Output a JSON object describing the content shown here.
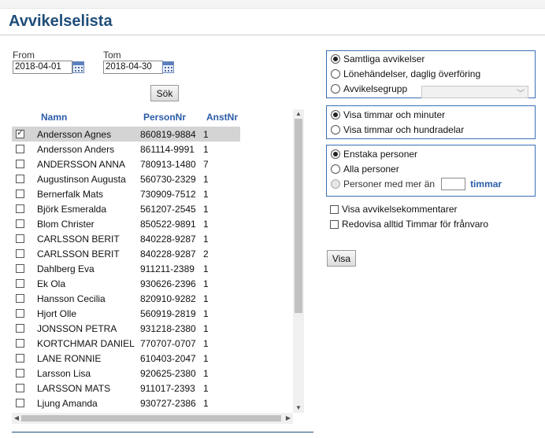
{
  "page": {
    "title": "Avvikelselista"
  },
  "filters": {
    "from_label": "From",
    "from_value": "2018-04-01",
    "tom_label": "Tom",
    "tom_value": "2018-04-30",
    "search_button": "Sök"
  },
  "list": {
    "columns": {
      "name": "Namn",
      "pnr": "PersonNr",
      "anst": "AnstNr"
    },
    "rows": [
      {
        "name": "Andersson Agnes",
        "pnr": "860819-9884",
        "anst": "1",
        "checked": true,
        "selected": true
      },
      {
        "name": "Andersson Anders",
        "pnr": "861114-9991",
        "anst": "1"
      },
      {
        "name": "ANDERSSON ANNA",
        "pnr": "780913-1480",
        "anst": "7"
      },
      {
        "name": "Augustinson Augusta",
        "pnr": "560730-2329",
        "anst": "1"
      },
      {
        "name": "Bernerfalk Mats",
        "pnr": "730909-7512",
        "anst": "1"
      },
      {
        "name": "Björk Esmeralda",
        "pnr": "561207-2545",
        "anst": "1"
      },
      {
        "name": "Blom Christer",
        "pnr": "850522-9891",
        "anst": "1"
      },
      {
        "name": "CARLSSON BERIT",
        "pnr": "840228-9287",
        "anst": "1"
      },
      {
        "name": "CARLSSON BERIT",
        "pnr": "840228-9287",
        "anst": "2"
      },
      {
        "name": "Dahlberg Eva",
        "pnr": "911211-2389",
        "anst": "1"
      },
      {
        "name": "Ek Ola",
        "pnr": "930626-2396",
        "anst": "1"
      },
      {
        "name": "Hansson Cecilia",
        "pnr": "820910-9282",
        "anst": "1"
      },
      {
        "name": "Hjort Olle",
        "pnr": "560919-2819",
        "anst": "1"
      },
      {
        "name": "JONSSON PETRA",
        "pnr": "931218-2380",
        "anst": "1"
      },
      {
        "name": "KORTCHMAR DANIEL",
        "pnr": "770707-0707",
        "anst": "1"
      },
      {
        "name": "LANE RONNIE",
        "pnr": "610403-2047",
        "anst": "1"
      },
      {
        "name": "Larsson Lisa",
        "pnr": "920625-2380",
        "anst": "1"
      },
      {
        "name": "LARSSON MATS",
        "pnr": "911017-2393",
        "anst": "1"
      },
      {
        "name": "Ljung Amanda",
        "pnr": "930727-2386",
        "anst": "1"
      }
    ]
  },
  "options": {
    "group1": {
      "all": "Samtliga avvikelser",
      "daily": "Lönehändelser, daglig överföring",
      "group": "Avvikelsegrupp",
      "selected": "all"
    },
    "group2": {
      "minutes": "Visa timmar och minuter",
      "hundredths": "Visa timmar och hundradelar",
      "selected": "minutes"
    },
    "group3": {
      "single": "Enstaka personer",
      "all": "Alla personer",
      "more_than": "Personer med mer än",
      "hours_value": "",
      "unit": "timmar",
      "selected": "single"
    },
    "show_comments": "Visa avvikelsekommentarer",
    "show_absence_hours": "Redovisa alltid Timmar för frånvaro",
    "show_button": "Visa"
  }
}
